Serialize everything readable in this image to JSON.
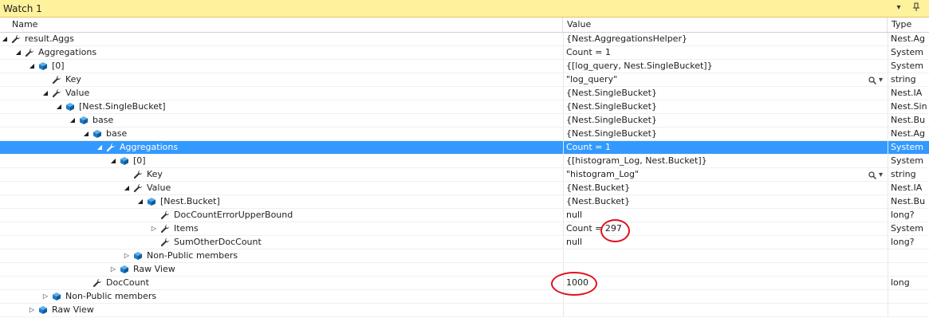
{
  "window": {
    "title": "Watch 1"
  },
  "columns": {
    "name": "Name",
    "value": "Value",
    "type": "Type"
  },
  "rows": [
    {
      "name": "result.Aggs",
      "value": "{Nest.AggregationsHelper}",
      "type": "Nest.Ag",
      "icon": "wrench",
      "expander": "expanded",
      "level": 0
    },
    {
      "name": "Aggregations",
      "value": "Count = 1",
      "type": "System",
      "icon": "wrench",
      "expander": "expanded",
      "level": 1
    },
    {
      "name": "[0]",
      "value": "{[log_query, Nest.SingleBucket]}",
      "type": "System",
      "icon": "cube",
      "expander": "expanded",
      "level": 2
    },
    {
      "name": "Key",
      "value": "\"log_query\"",
      "type": "string",
      "icon": "wrench",
      "expander": "none",
      "level": 3,
      "search": true
    },
    {
      "name": "Value",
      "value": "{Nest.SingleBucket}",
      "type": "Nest.IA",
      "icon": "wrench",
      "expander": "expanded",
      "level": 3
    },
    {
      "name": "[Nest.SingleBucket]",
      "value": "{Nest.SingleBucket}",
      "type": "Nest.Sin",
      "icon": "cube",
      "expander": "expanded",
      "level": 4
    },
    {
      "name": "base",
      "value": "{Nest.SingleBucket}",
      "type": "Nest.Bu",
      "icon": "cube",
      "expander": "expanded",
      "level": 5
    },
    {
      "name": "base",
      "value": "{Nest.SingleBucket}",
      "type": "Nest.Ag",
      "icon": "cube",
      "expander": "expanded",
      "level": 6
    },
    {
      "name": "Aggregations",
      "value": "Count = 1",
      "type": "System",
      "icon": "wrench",
      "expander": "expanded",
      "level": 7,
      "selected": true
    },
    {
      "name": "[0]",
      "value": "{[histogram_Log, Nest.Bucket]}",
      "type": "System",
      "icon": "cube",
      "expander": "expanded",
      "level": 8
    },
    {
      "name": "Key",
      "value": "\"histogram_Log\"",
      "type": "string",
      "icon": "wrench",
      "expander": "none",
      "level": 9,
      "search": true
    },
    {
      "name": "Value",
      "value": "{Nest.Bucket}",
      "type": "Nest.IA",
      "icon": "wrench",
      "expander": "expanded",
      "level": 9
    },
    {
      "name": "[Nest.Bucket]",
      "value": "{Nest.Bucket}",
      "type": "Nest.Bu",
      "icon": "cube",
      "expander": "expanded",
      "level": 10
    },
    {
      "name": "DocCountErrorUpperBound",
      "value": "null",
      "type": "long?",
      "icon": "wrench",
      "expander": "none",
      "level": 11
    },
    {
      "name": "Items",
      "value": "Count = 297",
      "type": "System",
      "icon": "wrench",
      "expander": "collapsed",
      "level": 11
    },
    {
      "name": "SumOtherDocCount",
      "value": "null",
      "type": "long?",
      "icon": "wrench",
      "expander": "none",
      "level": 11
    },
    {
      "name": "Non-Public members",
      "value": "",
      "type": "",
      "icon": "cube",
      "expander": "collapsed",
      "level": 9
    },
    {
      "name": "Raw View",
      "value": "",
      "type": "",
      "icon": "cube",
      "expander": "collapsed",
      "level": 8
    },
    {
      "name": "DocCount",
      "value": "1000",
      "type": "long",
      "icon": "wrench",
      "expander": "none",
      "level": 6
    },
    {
      "name": "Non-Public members",
      "value": "",
      "type": "",
      "icon": "cube",
      "expander": "collapsed",
      "level": 3
    },
    {
      "name": "Raw View",
      "value": "",
      "type": "",
      "icon": "cube",
      "expander": "collapsed",
      "level": 2
    }
  ],
  "icons": {
    "wrench": "wrench-icon",
    "cube": "cube-icon",
    "search": "magnifier-icon",
    "dropdown": "chevron-down-icon",
    "pin": "pin-icon"
  },
  "colors": {
    "title_bar": "#fff29d",
    "selection": "#3399ff",
    "annotation": "#e0101c",
    "cube": "#1e7ac7"
  },
  "search_tool": {
    "magnifier": "🔍",
    "dropdown": "▾"
  }
}
